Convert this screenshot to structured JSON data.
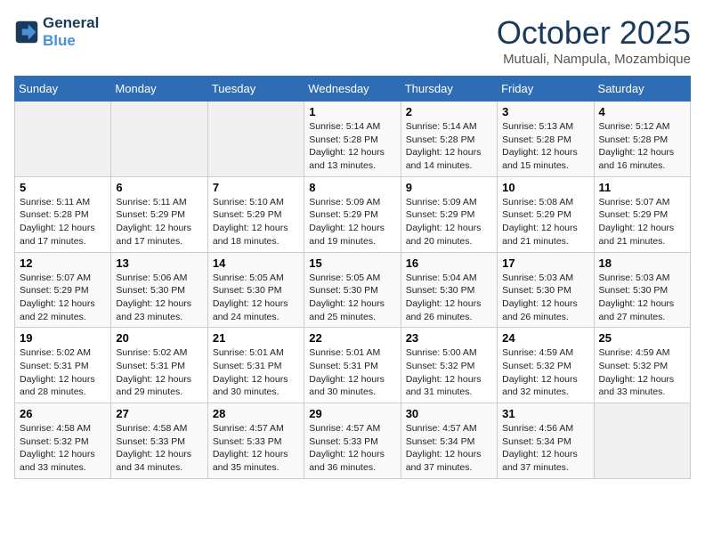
{
  "logo": {
    "line1": "General",
    "line2": "Blue"
  },
  "title": "October 2025",
  "subtitle": "Mutuali, Nampula, Mozambique",
  "days_of_week": [
    "Sunday",
    "Monday",
    "Tuesday",
    "Wednesday",
    "Thursday",
    "Friday",
    "Saturday"
  ],
  "weeks": [
    [
      {
        "day": "",
        "info": ""
      },
      {
        "day": "",
        "info": ""
      },
      {
        "day": "",
        "info": ""
      },
      {
        "day": "1",
        "info": "Sunrise: 5:14 AM\nSunset: 5:28 PM\nDaylight: 12 hours\nand 13 minutes."
      },
      {
        "day": "2",
        "info": "Sunrise: 5:14 AM\nSunset: 5:28 PM\nDaylight: 12 hours\nand 14 minutes."
      },
      {
        "day": "3",
        "info": "Sunrise: 5:13 AM\nSunset: 5:28 PM\nDaylight: 12 hours\nand 15 minutes."
      },
      {
        "day": "4",
        "info": "Sunrise: 5:12 AM\nSunset: 5:28 PM\nDaylight: 12 hours\nand 16 minutes."
      }
    ],
    [
      {
        "day": "5",
        "info": "Sunrise: 5:11 AM\nSunset: 5:28 PM\nDaylight: 12 hours\nand 17 minutes."
      },
      {
        "day": "6",
        "info": "Sunrise: 5:11 AM\nSunset: 5:29 PM\nDaylight: 12 hours\nand 17 minutes."
      },
      {
        "day": "7",
        "info": "Sunrise: 5:10 AM\nSunset: 5:29 PM\nDaylight: 12 hours\nand 18 minutes."
      },
      {
        "day": "8",
        "info": "Sunrise: 5:09 AM\nSunset: 5:29 PM\nDaylight: 12 hours\nand 19 minutes."
      },
      {
        "day": "9",
        "info": "Sunrise: 5:09 AM\nSunset: 5:29 PM\nDaylight: 12 hours\nand 20 minutes."
      },
      {
        "day": "10",
        "info": "Sunrise: 5:08 AM\nSunset: 5:29 PM\nDaylight: 12 hours\nand 21 minutes."
      },
      {
        "day": "11",
        "info": "Sunrise: 5:07 AM\nSunset: 5:29 PM\nDaylight: 12 hours\nand 21 minutes."
      }
    ],
    [
      {
        "day": "12",
        "info": "Sunrise: 5:07 AM\nSunset: 5:29 PM\nDaylight: 12 hours\nand 22 minutes."
      },
      {
        "day": "13",
        "info": "Sunrise: 5:06 AM\nSunset: 5:30 PM\nDaylight: 12 hours\nand 23 minutes."
      },
      {
        "day": "14",
        "info": "Sunrise: 5:05 AM\nSunset: 5:30 PM\nDaylight: 12 hours\nand 24 minutes."
      },
      {
        "day": "15",
        "info": "Sunrise: 5:05 AM\nSunset: 5:30 PM\nDaylight: 12 hours\nand 25 minutes."
      },
      {
        "day": "16",
        "info": "Sunrise: 5:04 AM\nSunset: 5:30 PM\nDaylight: 12 hours\nand 26 minutes."
      },
      {
        "day": "17",
        "info": "Sunrise: 5:03 AM\nSunset: 5:30 PM\nDaylight: 12 hours\nand 26 minutes."
      },
      {
        "day": "18",
        "info": "Sunrise: 5:03 AM\nSunset: 5:30 PM\nDaylight: 12 hours\nand 27 minutes."
      }
    ],
    [
      {
        "day": "19",
        "info": "Sunrise: 5:02 AM\nSunset: 5:31 PM\nDaylight: 12 hours\nand 28 minutes."
      },
      {
        "day": "20",
        "info": "Sunrise: 5:02 AM\nSunset: 5:31 PM\nDaylight: 12 hours\nand 29 minutes."
      },
      {
        "day": "21",
        "info": "Sunrise: 5:01 AM\nSunset: 5:31 PM\nDaylight: 12 hours\nand 30 minutes."
      },
      {
        "day": "22",
        "info": "Sunrise: 5:01 AM\nSunset: 5:31 PM\nDaylight: 12 hours\nand 30 minutes."
      },
      {
        "day": "23",
        "info": "Sunrise: 5:00 AM\nSunset: 5:32 PM\nDaylight: 12 hours\nand 31 minutes."
      },
      {
        "day": "24",
        "info": "Sunrise: 4:59 AM\nSunset: 5:32 PM\nDaylight: 12 hours\nand 32 minutes."
      },
      {
        "day": "25",
        "info": "Sunrise: 4:59 AM\nSunset: 5:32 PM\nDaylight: 12 hours\nand 33 minutes."
      }
    ],
    [
      {
        "day": "26",
        "info": "Sunrise: 4:58 AM\nSunset: 5:32 PM\nDaylight: 12 hours\nand 33 minutes."
      },
      {
        "day": "27",
        "info": "Sunrise: 4:58 AM\nSunset: 5:33 PM\nDaylight: 12 hours\nand 34 minutes."
      },
      {
        "day": "28",
        "info": "Sunrise: 4:57 AM\nSunset: 5:33 PM\nDaylight: 12 hours\nand 35 minutes."
      },
      {
        "day": "29",
        "info": "Sunrise: 4:57 AM\nSunset: 5:33 PM\nDaylight: 12 hours\nand 36 minutes."
      },
      {
        "day": "30",
        "info": "Sunrise: 4:57 AM\nSunset: 5:34 PM\nDaylight: 12 hours\nand 37 minutes."
      },
      {
        "day": "31",
        "info": "Sunrise: 4:56 AM\nSunset: 5:34 PM\nDaylight: 12 hours\nand 37 minutes."
      },
      {
        "day": "",
        "info": ""
      }
    ]
  ]
}
